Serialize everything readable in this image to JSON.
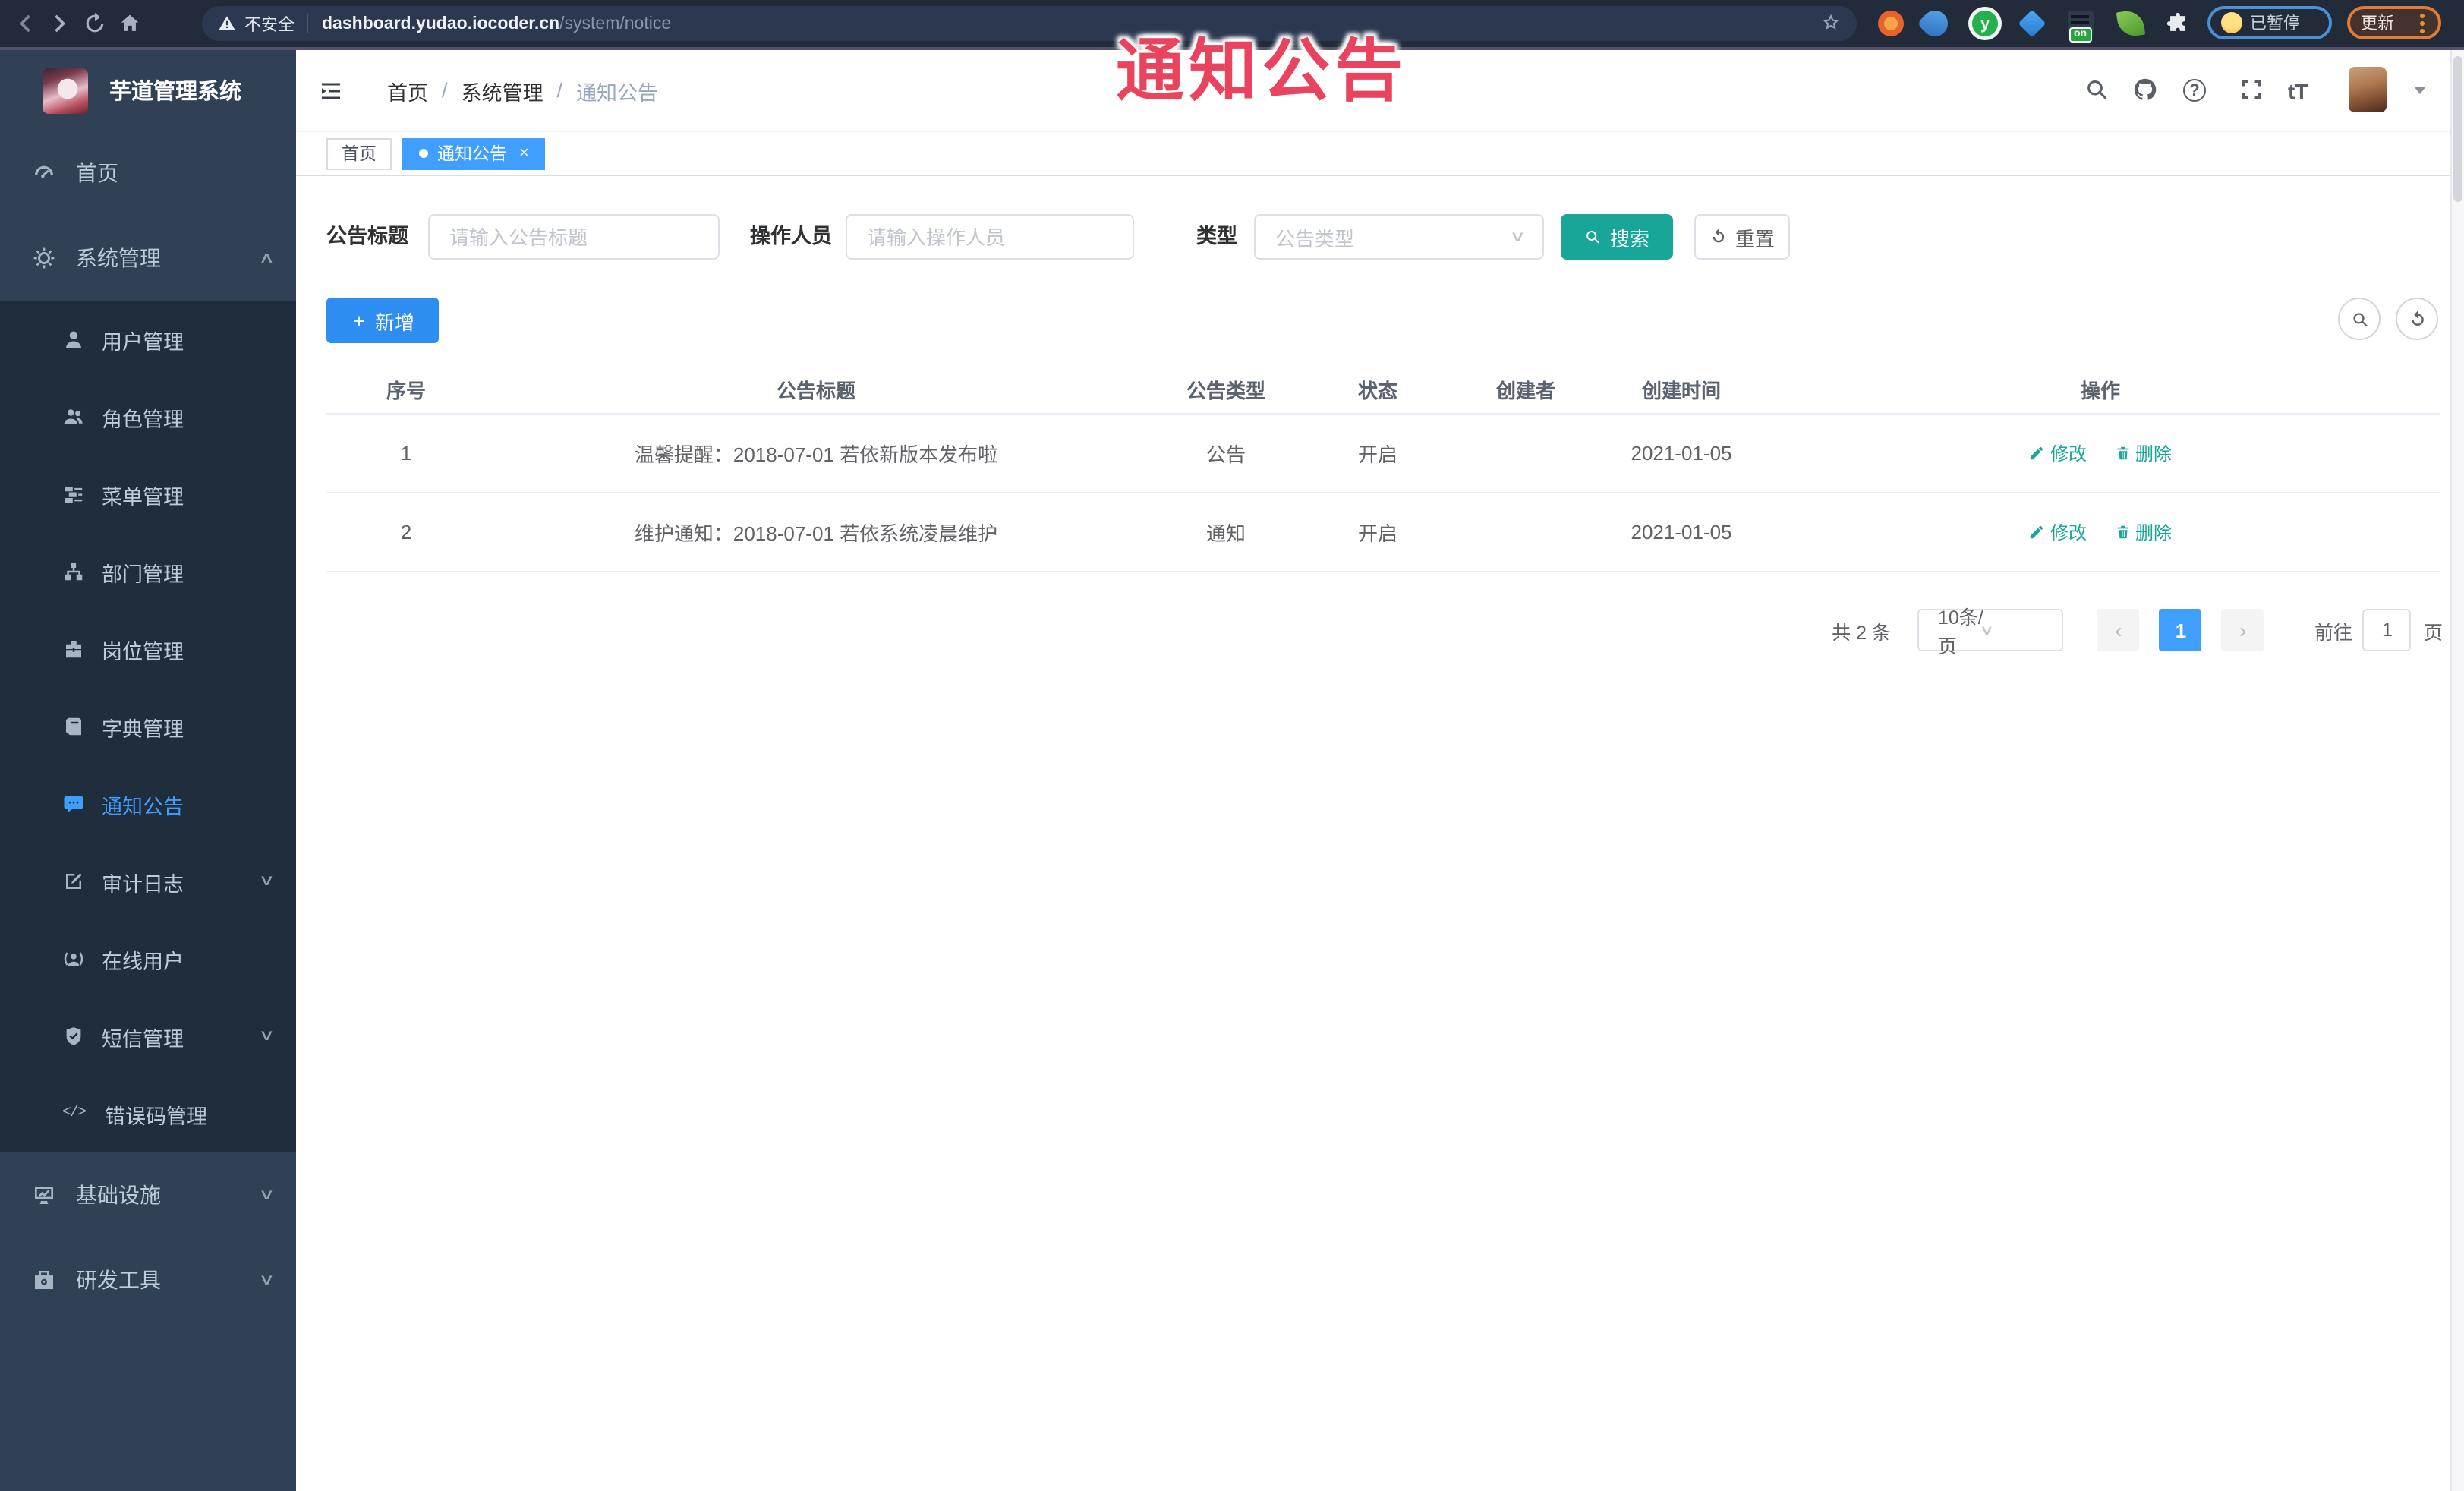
{
  "colors": {
    "accent_blue": "#409eff",
    "theme_teal": "#17a697",
    "annotation_red": "#e9435e",
    "sidebar_bg": "#304156",
    "sidebar_submenu_bg": "#1f2d3d",
    "chrome_bg": "#212b3a"
  },
  "browser": {
    "security_warning": "不安全",
    "url_host": "dashboard.yudao.iocoder.cn",
    "url_path": "/system/notice",
    "paused_badge": "已暂停",
    "update_label": "更新",
    "extension_on_badge": "on"
  },
  "annotation": {
    "text": "通知公告"
  },
  "sidebar": {
    "app_title": "芋道管理系统",
    "items": [
      {
        "label": "首页"
      },
      {
        "label": "系统管理"
      },
      {
        "label": "用户管理"
      },
      {
        "label": "角色管理"
      },
      {
        "label": "菜单管理"
      },
      {
        "label": "部门管理"
      },
      {
        "label": "岗位管理"
      },
      {
        "label": "字典管理"
      },
      {
        "label": "通知公告"
      },
      {
        "label": "审计日志"
      },
      {
        "label": "在线用户"
      },
      {
        "label": "短信管理"
      },
      {
        "label": "错误码管理"
      },
      {
        "label": "基础设施"
      },
      {
        "label": "研发工具"
      }
    ]
  },
  "header": {
    "breadcrumb": [
      "首页",
      "系统管理",
      "通知公告"
    ],
    "separator": "/",
    "font_icon_text": "tT"
  },
  "tabs": {
    "items": [
      {
        "label": "首页"
      },
      {
        "label": "通知公告"
      }
    ],
    "close_symbol": "×"
  },
  "filters": {
    "title_label": "公告标题",
    "title_placeholder": "请输入公告标题",
    "operator_label": "操作人员",
    "operator_placeholder": "请输入操作人员",
    "type_label": "类型",
    "type_placeholder": "公告类型",
    "search_label": "搜索",
    "reset_label": "重置"
  },
  "toolbar": {
    "add_label": "新增"
  },
  "table": {
    "columns": [
      "序号",
      "公告标题",
      "公告类型",
      "状态",
      "创建者",
      "创建时间",
      "操作"
    ],
    "edit_label": "修改",
    "delete_label": "删除",
    "rows": [
      {
        "index": "1",
        "title": "温馨提醒：2018-07-01 若依新版本发布啦",
        "type": "公告",
        "status": "开启",
        "creator": "",
        "create_time": "2021-01-05"
      },
      {
        "index": "2",
        "title": "维护通知：2018-07-01 若依系统凌晨维护",
        "type": "通知",
        "status": "开启",
        "creator": "",
        "create_time": "2021-01-05"
      }
    ]
  },
  "pagination": {
    "total_text": "共 2 条",
    "page_size": "10条/页",
    "current_page": "1",
    "goto_label": "前往",
    "goto_value": "1",
    "page_unit": "页"
  },
  "glyphs": {
    "question": "?",
    "chevron_up": "∧",
    "chevron_down": "∨",
    "prev": "‹",
    "next": "›",
    "close": "×",
    "plus": "+",
    "y_logo": "y",
    "code": "</>"
  }
}
